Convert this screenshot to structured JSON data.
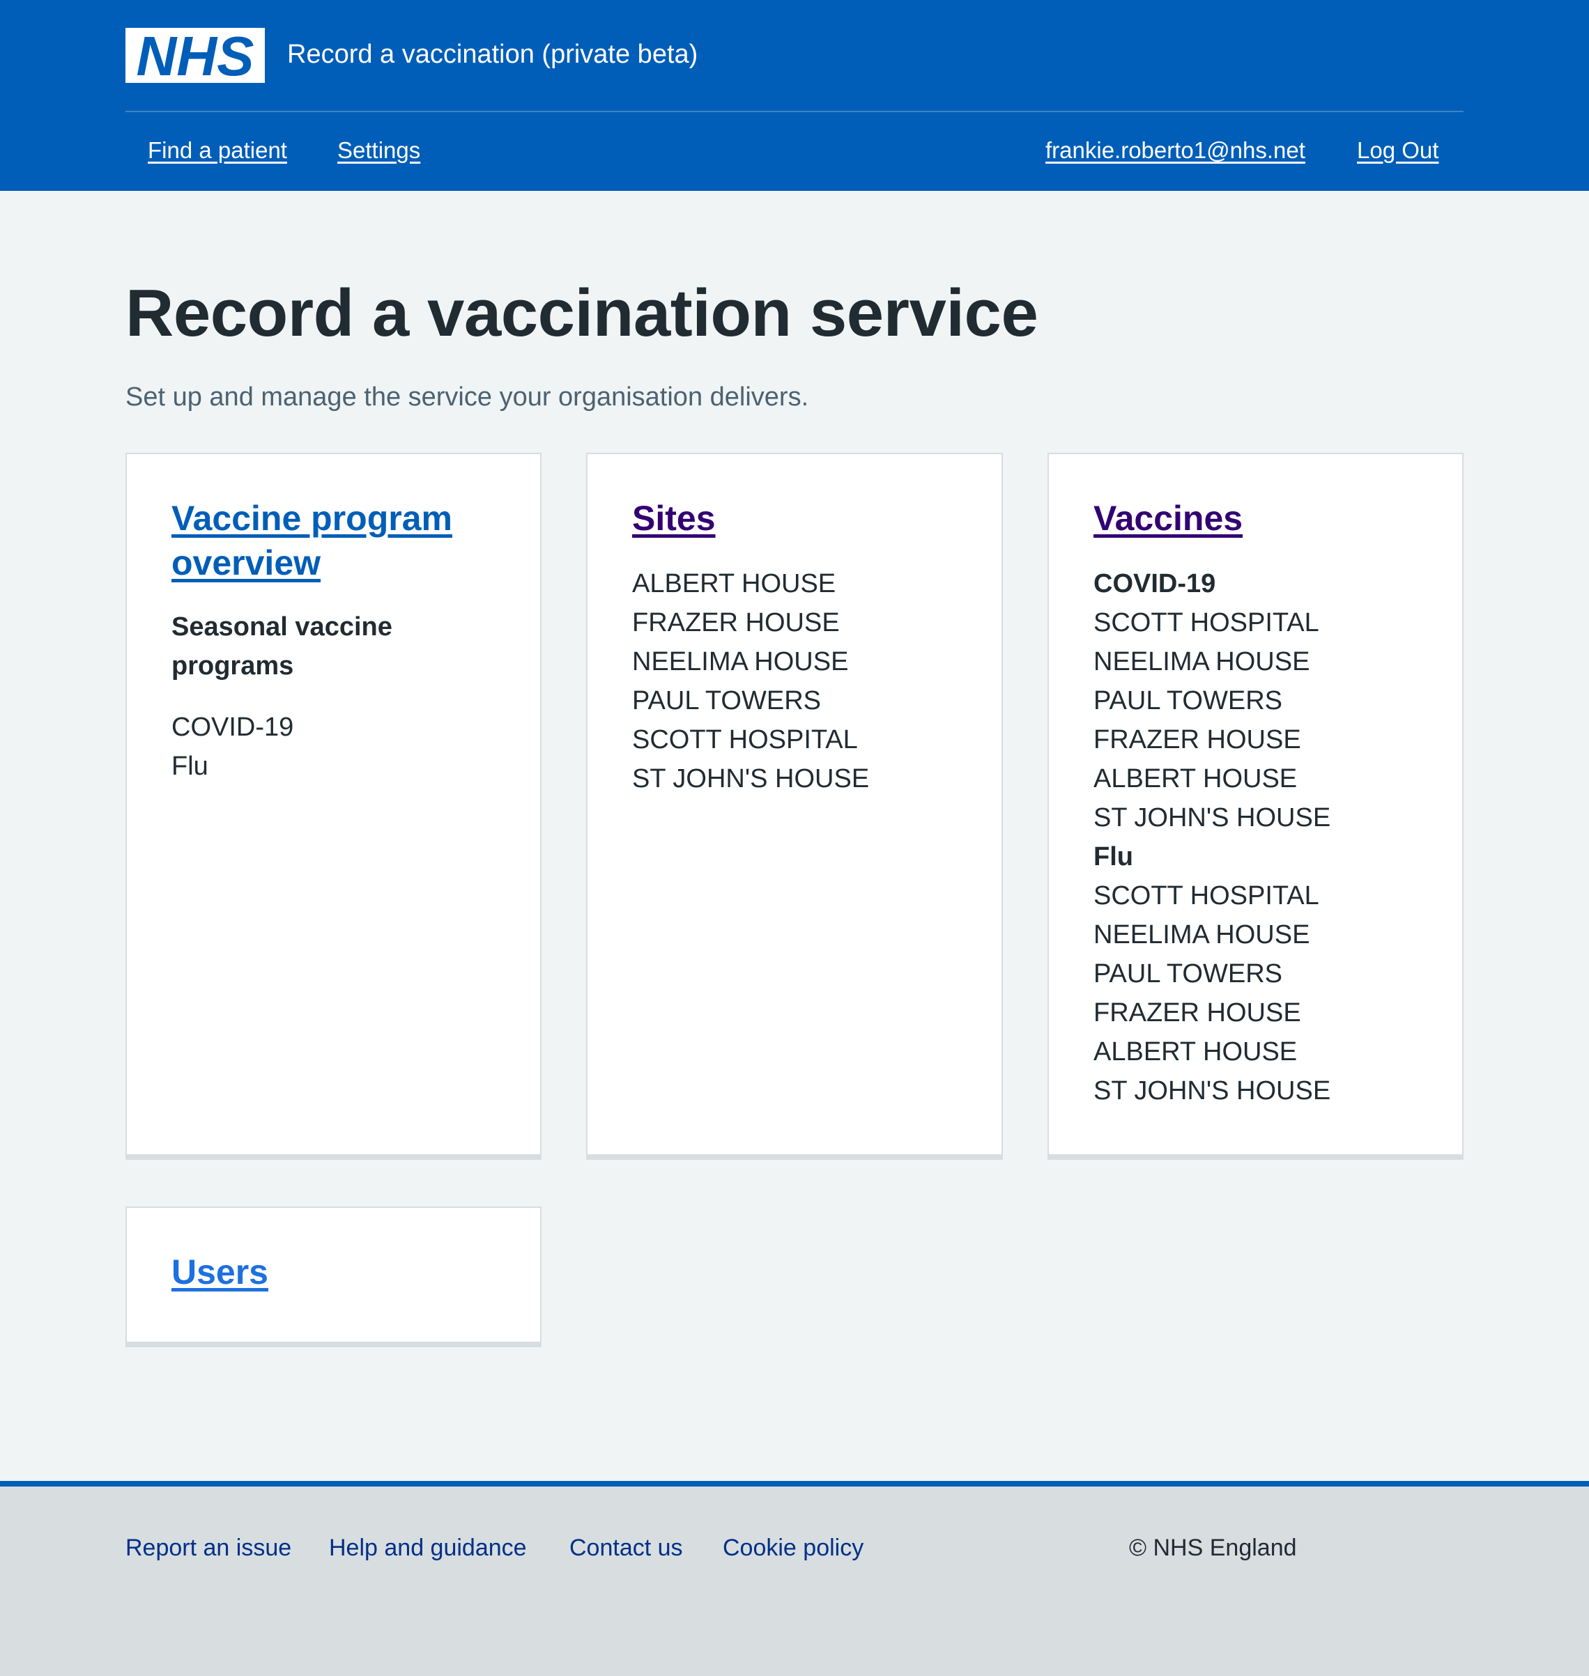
{
  "header": {
    "logo_text": "NHS",
    "service_name": "Record a vaccination (private beta)",
    "nav": {
      "find_patient": "Find a patient",
      "settings": "Settings",
      "user_email": "frankie.roberto1@nhs.net",
      "log_out": "Log Out"
    },
    "colors": {
      "brand": "#005eb8"
    }
  },
  "main": {
    "title": "Record a vaccination service",
    "lede": "Set up and manage the service your organisation delivers.",
    "cards": {
      "program": {
        "heading": "Vaccine program overview",
        "subheading": "Seasonal vaccine programs",
        "items": [
          "COVID-19",
          "Flu"
        ]
      },
      "sites": {
        "heading": "Sites",
        "items": [
          "ALBERT HOUSE",
          "FRAZER HOUSE",
          "NEELIMA HOUSE",
          "PAUL TOWERS",
          "SCOTT HOSPITAL",
          "ST JOHN'S HOUSE"
        ]
      },
      "vaccines": {
        "heading": "Vaccines",
        "groups": [
          {
            "name": "COVID-19",
            "sites": [
              "SCOTT HOSPITAL",
              "NEELIMA HOUSE",
              "PAUL TOWERS",
              "FRAZER HOUSE",
              "ALBERT HOUSE",
              "ST JOHN'S HOUSE"
            ]
          },
          {
            "name": "Flu",
            "sites": [
              "SCOTT HOSPITAL",
              "NEELIMA HOUSE",
              "PAUL TOWERS",
              "FRAZER HOUSE",
              "ALBERT HOUSE",
              "ST JOHN'S HOUSE"
            ]
          }
        ]
      },
      "users": {
        "heading": "Users"
      }
    }
  },
  "footer": {
    "links": [
      "Report an issue",
      "Help and guidance",
      "Contact us",
      "Cookie policy"
    ],
    "copyright": "© NHS England"
  }
}
